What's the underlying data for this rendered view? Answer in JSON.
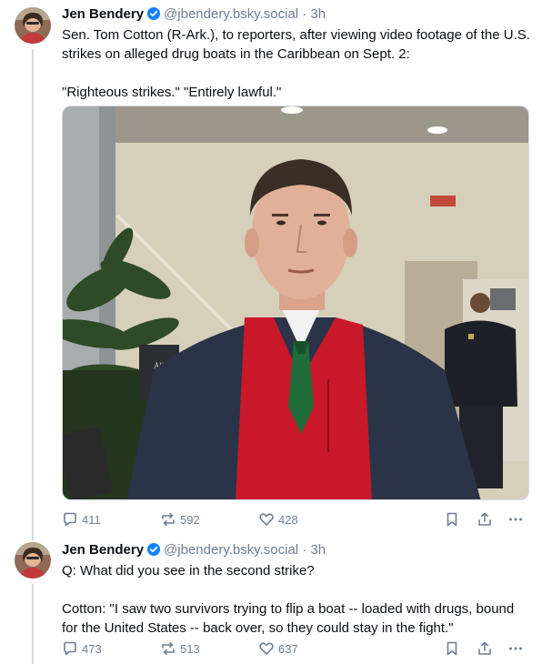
{
  "posts": [
    {
      "author_name": "Jen Bendery",
      "handle": "@jbendery.bsky.social",
      "separator": "·",
      "time": "3h",
      "text": "Sen. Tom Cotton (R-Ark.), to reporters, after viewing video footage of the U.S. strikes on alleged drug boats in the Caribbean on Sept. 2:\n\n\"Righteous strikes.\" \"Entirely lawful.\"",
      "replies": "411",
      "reposts": "592",
      "likes": "428"
    },
    {
      "author_name": "Jen Bendery",
      "handle": "@jbendery.bsky.social",
      "separator": "·",
      "time": "3h",
      "text": "Q: What did you see in the second strike?\n\nCotton: \"I saw two survivors trying to flip a boat -- loaded with drugs, bound for the United States -- back over, so they could stay in the fight.\"",
      "replies": "473",
      "reposts": "513",
      "likes": "637"
    }
  ],
  "media_sign_text": "All Tour",
  "colors": {
    "accent": "#1083fe",
    "muted": "#6f7f92",
    "tie": "#1f6b3a",
    "sweater": "#c8182a"
  }
}
